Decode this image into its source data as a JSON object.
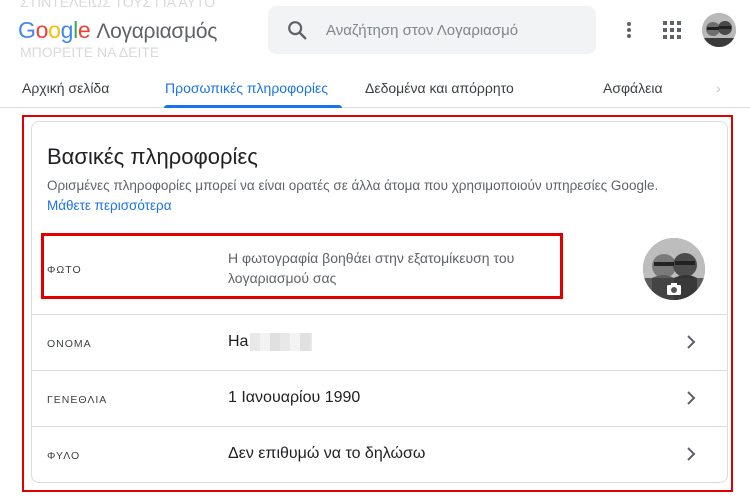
{
  "header": {
    "logo_letters": [
      "G",
      "o",
      "o",
      "g",
      "l",
      "e"
    ],
    "product": "Λογαριασμός",
    "search_placeholder": "Αναζήτηση στον Λογαριασμό"
  },
  "tabs": [
    {
      "label": "Αρχική σελίδα",
      "active": false
    },
    {
      "label": "Προσωπικές πληροφορίες",
      "active": true
    },
    {
      "label": "Δεδομένα και απόρρητο",
      "active": false
    },
    {
      "label": "Ασφάλεια",
      "active": false
    }
  ],
  "card": {
    "title": "Βασικές πληροφορίες",
    "description": "Ορισμένες πληροφορίες μπορεί να είναι ορατές σε άλλα άτομα που χρησιμοποιούν υπηρεσίες Google.",
    "learn_more": "Μάθετε περισσότερα",
    "rows": {
      "photo": {
        "label": "ΦΩΤΟ",
        "value": "Η φωτογραφία βοηθάει στην εξατομίκευση του λογαριασμού σας"
      },
      "name": {
        "label": "ΟΝΟΜΑ",
        "value": "Ha"
      },
      "birthday": {
        "label": "ΓΕΝΕΘΛΙΑ",
        "value": "1 Ιανουαρίου 1990"
      },
      "gender": {
        "label": "ΦΥΛΟ",
        "value": "Δεν επιθυμώ να το δηλώσω"
      }
    }
  },
  "colors": {
    "accent": "#1a73e8",
    "annotation_red": "#e00000"
  }
}
